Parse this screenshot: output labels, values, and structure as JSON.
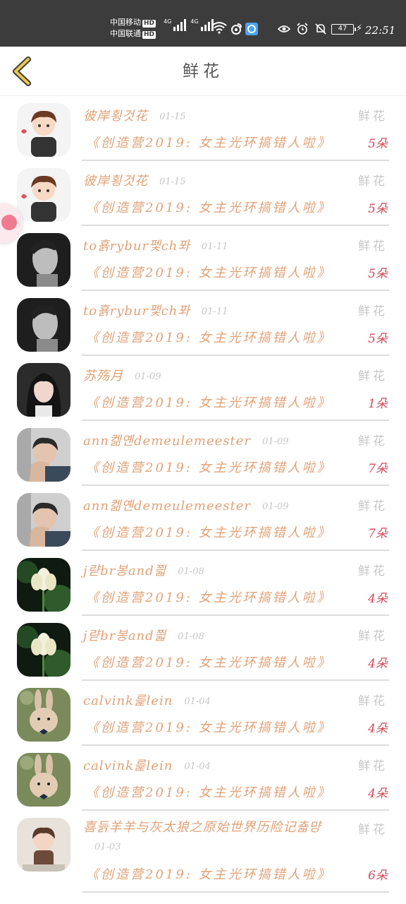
{
  "status_bar": {
    "carrier1": "中国移动",
    "carrier2": "中国联通",
    "hd": "HD",
    "net1": "4G",
    "net2": "4G",
    "battery": "47",
    "time": "22:51"
  },
  "header": {
    "title": "鲜花"
  },
  "gift_label": "鲜花",
  "entries": [
    {
      "user": "彼岸횡것花",
      "date": "01-15",
      "work": "《创造营2019: 女主光环搞错人啦》",
      "count": "5朵",
      "avatar": "cartoon-boy"
    },
    {
      "user": "彼岸횡것花",
      "date": "01-15",
      "work": "《创造营2019: 女主光环搞错人啦》",
      "count": "5朵",
      "avatar": "cartoon-boy"
    },
    {
      "user": "to횱rybur펯ch퐈",
      "date": "01-11",
      "work": "《创造营2019: 女主光环搞错人啦》",
      "count": "5朵",
      "avatar": "bw-man"
    },
    {
      "user": "to횱rybur펯ch퐈",
      "date": "01-11",
      "work": "《创造营2019: 女主光环搞错人啦》",
      "count": "5朵",
      "avatar": "bw-man"
    },
    {
      "user": "苏殇月",
      "date": "01-09",
      "work": "《创造营2019: 女主光环搞错人啦》",
      "count": "1朵",
      "avatar": "girl"
    },
    {
      "user": "ann켊옌demeulemeester",
      "date": "01-09",
      "work": "《创造营2019: 女主光环搞错人啦》",
      "count": "7朵",
      "avatar": "young-man"
    },
    {
      "user": "ann켊옌demeulemeester",
      "date": "01-09",
      "work": "《创造营2019: 女主光环搞错人啦》",
      "count": "7朵",
      "avatar": "young-man"
    },
    {
      "user": "j랻br봉and쯻",
      "date": "01-08",
      "work": "《创造营2019: 女主光环搞错人啦》",
      "count": "4朵",
      "avatar": "lotus"
    },
    {
      "user": "j랻br봉and쯻",
      "date": "01-08",
      "work": "《创造营2019: 女主光环搞错人啦》",
      "count": "4朵",
      "avatar": "lotus"
    },
    {
      "user": "calvink릁lein",
      "date": "01-04",
      "work": "《创造营2019: 女主光环搞错人啦》",
      "count": "4朵",
      "avatar": "rabbit"
    },
    {
      "user": "calvink릁lein",
      "date": "01-04",
      "work": "《创造营2019: 女主光环搞错人啦》",
      "count": "4朵",
      "avatar": "rabbit"
    },
    {
      "user": "喜듥羊羊与灰太狼之原始世界历险记춃먕",
      "date": "01-03",
      "work": "《创造营2019: 女主光环搞错人啦》",
      "count": "6朵",
      "avatar": "doll"
    }
  ],
  "colors": {
    "accent_orange": "#e1a277",
    "count_red": "#d24a58",
    "muted": "#c7c7c7",
    "back_arrow": "#e8c84a"
  }
}
